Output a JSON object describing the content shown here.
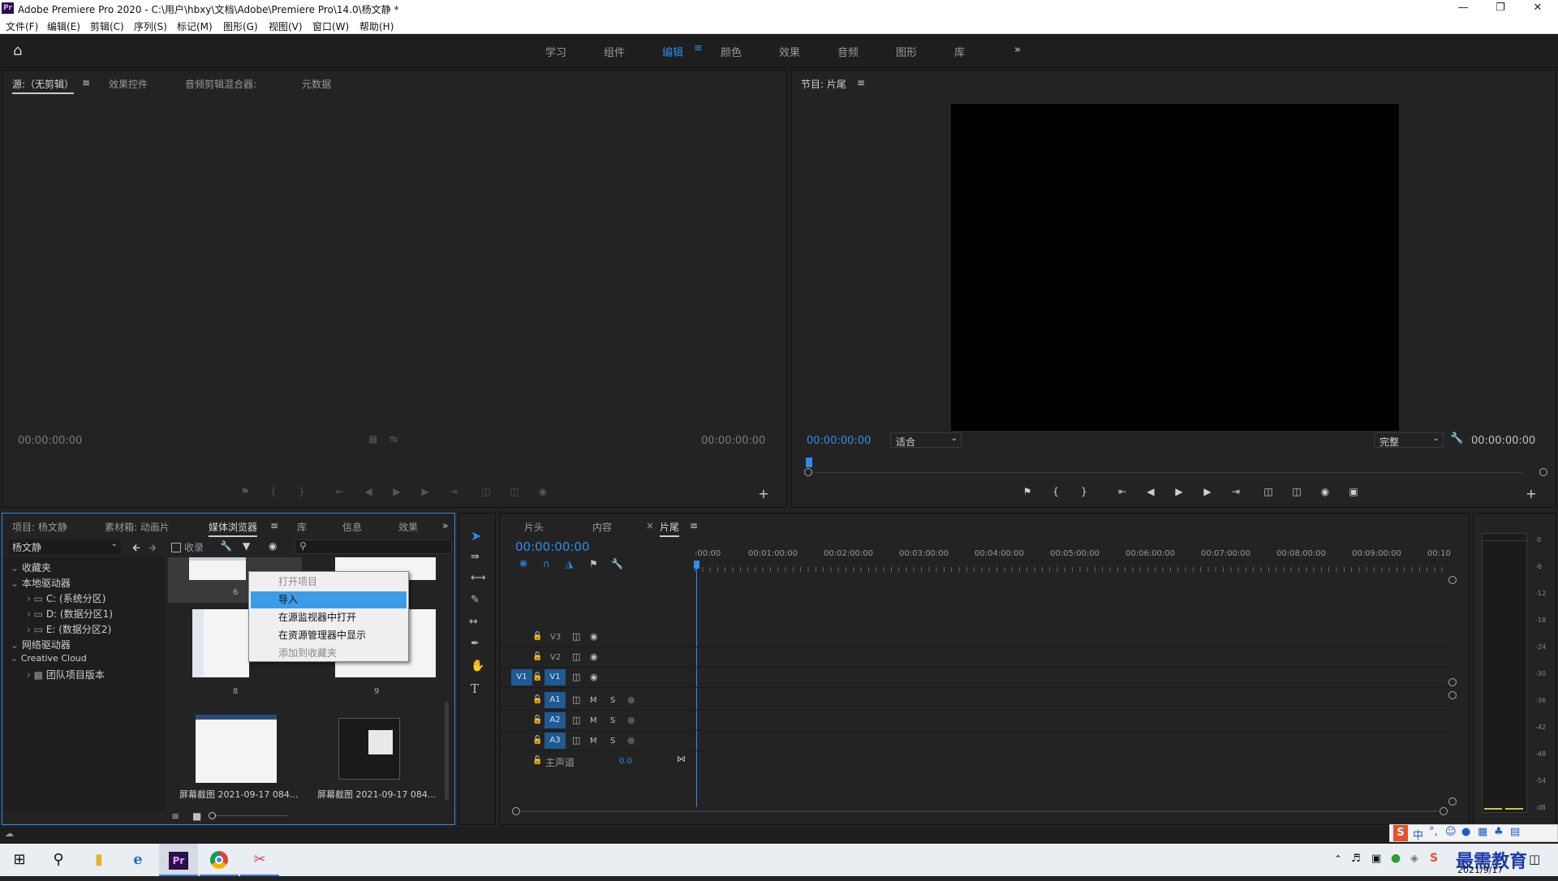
{
  "app": {
    "icon": "Pr",
    "title": "Adobe Premiere Pro 2020 - C:\\用户\\hbxy\\文档\\Adobe\\Premiere Pro\\14.0\\杨文静 *"
  },
  "menu": [
    "文件(F)",
    "编辑(E)",
    "剪辑(C)",
    "序列(S)",
    "标记(M)",
    "图形(G)",
    "视图(V)",
    "窗口(W)",
    "帮助(H)"
  ],
  "workspaces": [
    "学习",
    "组件",
    "编辑",
    "颜色",
    "效果",
    "音频",
    "图形",
    "库"
  ],
  "workspace_active": "编辑",
  "source_panel": {
    "tabs": [
      "源:（无剪辑）",
      "效果控件",
      "音频剪辑混合器:",
      "元数据"
    ],
    "tc_left": "00:00:00:00",
    "tc_right": "00:00:00:00"
  },
  "program_panel": {
    "title": "节目: 片尾",
    "tc_left": "00:00:00:00",
    "fit": "适合",
    "quality": "完整",
    "tc_right": "00:00:00:00"
  },
  "project_panel": {
    "tabs": [
      "项目: 杨文静",
      "素材箱: 动画片",
      "媒体浏览器",
      "库",
      "信息",
      "效果"
    ],
    "ingest_label": "收录",
    "location": "杨文静",
    "tree": [
      {
        "label": "收藏夹",
        "level": 0
      },
      {
        "label": "本地驱动器",
        "level": 0
      },
      {
        "label": "C: (系统分区)",
        "level": 1
      },
      {
        "label": "D: (数据分区1)",
        "level": 1
      },
      {
        "label": "E: (数据分区2)",
        "level": 1
      },
      {
        "label": "网络驱动器",
        "level": 0
      },
      {
        "label": "Creative Cloud",
        "level": 0
      },
      {
        "label": "团队项目版本",
        "level": 1
      }
    ],
    "thumbs": [
      "6",
      "8",
      "9",
      "屏幕截图 2021-09-17 084...",
      "屏幕截图 2021-09-17 084..."
    ]
  },
  "context_menu": {
    "items": [
      {
        "label": "打开项目",
        "state": "disabled"
      },
      {
        "label": "导入",
        "state": "selected"
      },
      {
        "label": "在源监视器中打开",
        "state": "normal"
      },
      {
        "label": "在资源管理器中显示",
        "state": "normal"
      },
      {
        "label": "添加到收藏夹",
        "state": "disabled"
      }
    ]
  },
  "timeline": {
    "tabs": [
      "片头",
      "内容",
      "片尾"
    ],
    "active_tab": "片尾",
    "timecode": "00:00:00:00",
    "ruler": [
      ":00:00",
      "00:01:00:00",
      "00:02:00:00",
      "00:03:00:00",
      "00:04:00:00",
      "00:05:00:00",
      "00:06:00:00",
      "00:07:00:00",
      "00:08:00:00",
      "00:09:00:00",
      "00:10"
    ],
    "video_tracks": [
      "V3",
      "V2",
      "V1"
    ],
    "audio_tracks": [
      "A1",
      "A2",
      "A3"
    ],
    "source_patch_v": "V1",
    "mute_label": "M",
    "solo_label": "S",
    "master_label": "主声道",
    "master_value": "0.0"
  },
  "meter_scale": [
    "0",
    "-6",
    "-12",
    "-18",
    "-24",
    "-30",
    "-36",
    "-42",
    "-48",
    "-54",
    "dB"
  ],
  "taskbar": {
    "date": "2021/9/17",
    "watermark": "最需教育",
    "ime": "中"
  },
  "colors": {
    "accent": "#2d8ceb",
    "panel": "#232323",
    "selection": "#3c9ce8"
  }
}
